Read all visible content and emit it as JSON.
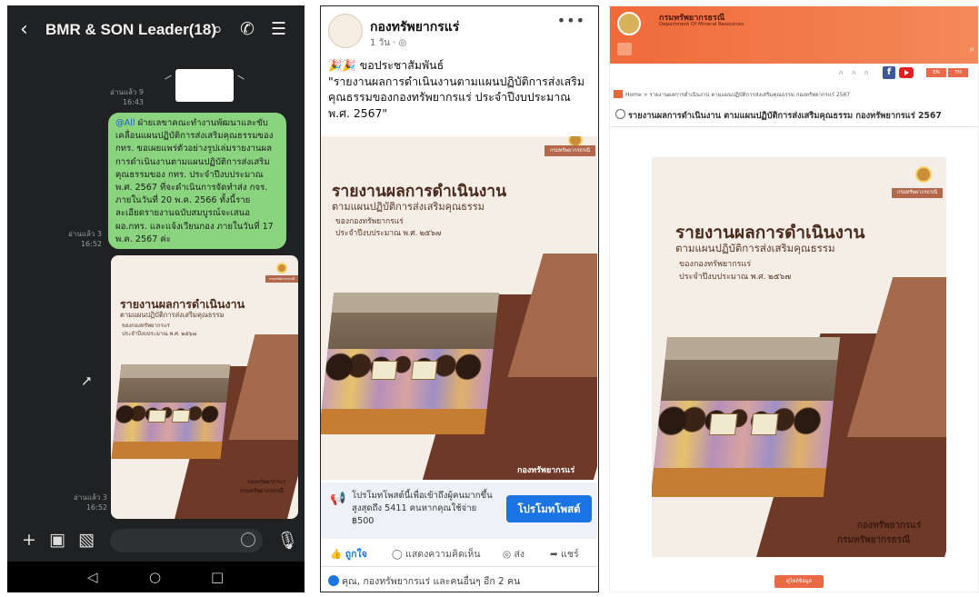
{
  "line": {
    "title": "BMR & SON Leader(18)",
    "read1": "อ่านแล้ว 9",
    "time1": "16:43",
    "message_mention": "@All",
    "message_text": " ฝ่ายเลขาคณะทำงานพัฒนาและขับเคลื่อนแผนปฏิบัติการส่งเสริมคุณธรรมของ กทร. ขอเผยแพร่ตัวอย่างรูปเล่มรายงานผลการดำเนินงานตามแผนปฏิบัติการส่งเสริมคุณธรรมของ กทร. ประจำปีงบประมาณ พ.ศ. 2567 ที่จะดำเนินการจัดทำส่ง กจร. ภายในวันที่ 20 พ.ค. 2566 ทั้งนี้รายละเอียดรายงานฉบับสมบูรณ์จะเสนอ ผอ.กทร. และแจ้งเวียนกอง ภายในวันที่ 17 พ.ค. 2567 ค่ะ",
    "read2": "อ่านแล้ว 3",
    "time2": "16:52",
    "read3": "อ่านแล้ว 3",
    "time3": "16:52",
    "icons": [
      "back-icon",
      "search-icon",
      "phone-icon",
      "menu-icon",
      "share-icon",
      "plus-icon",
      "camera-icon",
      "gallery-icon",
      "emoji-icon",
      "mic-icon",
      "nav-back-icon",
      "nav-home-icon",
      "nav-recent-icon"
    ]
  },
  "cover": {
    "tag": "กรมทรัพยากรธรณี",
    "title": "รายงานผลการดำเนินงาน",
    "subtitle": "ตามแผนปฏิบัติการส่งเสริมคุณธรรม",
    "org": "ของกองทรัพยากรแร่",
    "year": "ประจำปีงบประมาณ พ.ศ. ๒๕๖๗",
    "footer1": "กองทรัพยากรแร่",
    "footer2": "กรมทรัพยากรธรณี"
  },
  "fb": {
    "page_name": "กองทรัพยากรแร่",
    "post_time": "1 วัน · ",
    "post_line1": "🎉🎉 ขอประชาสัมพันธ์",
    "post_line2": "\"รายงานผลการดำเนินงานตามแผนปฏิบัติการส่งเสริมคุณธรรมของกองทรัพยากรแร่ ประจำปีงบประมาณ พ.ศ. 2567\"",
    "promo_text": "โปรโมทโพสต์นี้เพื่อเข้าถึงผู้คนมากขึ้นสูงสุดถึง 5411 คนหากคุณใช้จ่าย ฿500",
    "promo_button": "โปรโมทโพสต์",
    "like": "ถูกใจ",
    "comment": "แสดงความคิดเห็น",
    "send": "ส่ง",
    "share": "แชร์",
    "reactions": "คุณ, กองทรัพยากรแร่ และคนอื่นๆ อีก 2 คน",
    "colors": {
      "primary": "#1b74e4"
    }
  },
  "dmr": {
    "site_name": "กรมทรัพยากรธรณี",
    "site_name_en": "Department Of Mineral Resources",
    "font_sizes": [
      "ก",
      "ก",
      "ก"
    ],
    "lang_en": "EN",
    "lang_th": "TH",
    "breadcrumb": "Home > รายงานผลการดำเนินงาน ตามแผนปฏิบัติการส่งเสริมคุณธรรม กองทรัพยากรแร่ 2567",
    "page_title": "รายงานผลการดำเนินงาน ตามแผนปฏิบัติการส่งเสริมคุณธรรม กองทรัพยากรแร่ 2567",
    "download": "ดูไฟล์ข้อมูล",
    "colors": {
      "accent": "#f06a3a"
    }
  }
}
